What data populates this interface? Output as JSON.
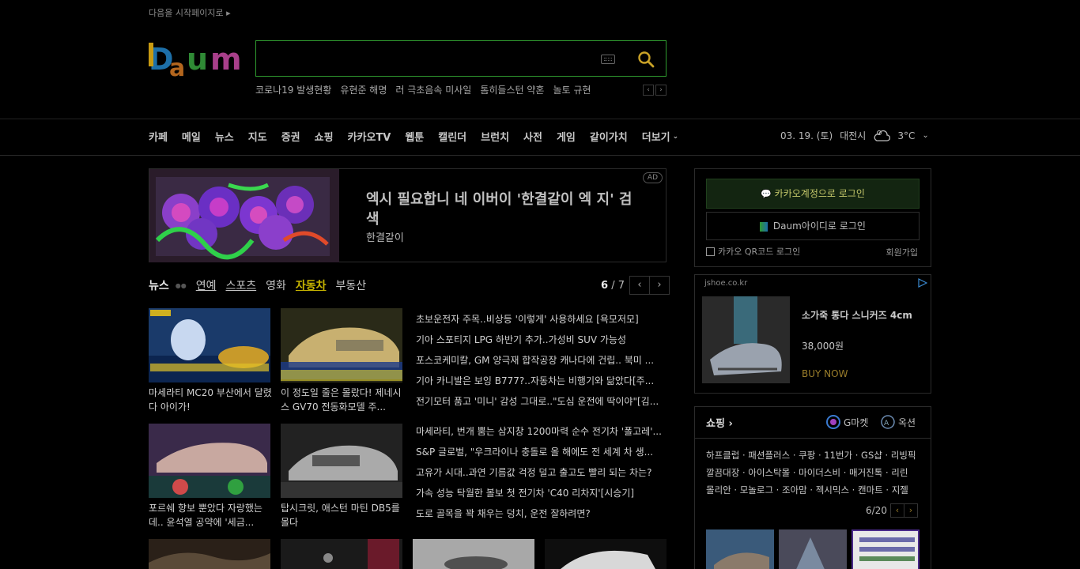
{
  "top": {
    "set_start": "다음을 시작페이지로 ▸"
  },
  "search": {
    "value": "",
    "trends": [
      "코로나19 발생현황",
      "유현준 해명",
      "러 극초음속 미사일",
      "톰히들스턴 약혼",
      "놀토 규현"
    ]
  },
  "gnb": {
    "items": [
      "카페",
      "메일",
      "뉴스",
      "지도",
      "증권",
      "쇼핑",
      "카카오TV",
      "웹툰",
      "캘린더",
      "브런치",
      "사전",
      "게임",
      "같이가치"
    ],
    "more": "더보기",
    "date": "03. 19. (토)",
    "city": "대전시",
    "temp": "3°C"
  },
  "ad": {
    "title": "엑시 필요합니 네 이버이 '한결같이 엑 지' 검색",
    "sub": "한결같이",
    "badge": "AD"
  },
  "news": {
    "tabs": [
      "뉴스",
      "연예",
      "스포츠",
      "영화",
      "자동차",
      "부동산"
    ],
    "page_current": "6",
    "page_total": "/ 7",
    "cards": [
      {
        "caption": "마세라티 MC20 부산에서 달렸다 아이가!"
      },
      {
        "caption": "이 정도일 줄은 몰랐다! 제네시스 GV70 전동화모델 주..."
      },
      {
        "caption": "포르쉐 향보 뿐았다 자랑했는데.. 윤석열 공약에 '세금..."
      },
      {
        "caption": "탑시크릿, 애스턴 마틴 DB5를 몰다"
      }
    ],
    "list1": [
      "초보운전자 주목..비상등 '이렇게' 사용하세요 [욕모저모]",
      "기아 스포티지 LPG 하반기 추가..가성비 SUV 가능성",
      "포스코케미칼, GM 양극재 합작공장 캐나다에 건립.. 북미 ...",
      "기아 카니발은 보잉 B777?..자동차는 비행기와 닮았다[주...",
      "전기모터 품고 '미니' 감성 그대로..\"도심 운전에 딱이야\"[김..."
    ],
    "list2": [
      "마세라티, 번개 뿜는 삼지창 1200마력 순수 전기차 '폴고레'...",
      "S&P 글로벌, \"우크라이나 충돌로 올 해에도 전 세계 차 생...",
      "고유가 시대..과연 기름값 걱정 덜고 출고도 빨리 되는 차는?",
      "가속 성능 탁월한 볼보 첫 전기차 'C40 리차지'[시승기]",
      "도로 골목을 꽉 채우는 덩치, 운전 잘하려면?"
    ]
  },
  "login": {
    "kakao": "카카오계정으로 로그인",
    "daum": "Daum아이디로 로그인",
    "qr": "카카오 QR코드 로그인",
    "join": "회원가입"
  },
  "shop_ad": {
    "domain": "jshoe.co.kr",
    "product": "소가죽 통다 스니커즈 4cm",
    "price": "38,000원",
    "cta": "BUY NOW"
  },
  "shopping": {
    "title": "쇼핑 ›",
    "gmarket": "G마켓",
    "auction": "옥션",
    "brands": [
      "하프클럽 · 패션플러스 · 쿠팡 · 11번가 · GS샵 · 리빙픽",
      "깔끔대장 · 아이스탁몰 · 마이더스비 · 매거진톡 · 리린",
      "몰리안 · 모놀로그 · 조아맘 · 젝시믹스 · 캔마트 · 지젤"
    ],
    "page": "6/20"
  },
  "colors": {
    "search_border": "#2f9a2f",
    "accent_active": "#c6b400",
    "buy": "#9a7d2a"
  }
}
